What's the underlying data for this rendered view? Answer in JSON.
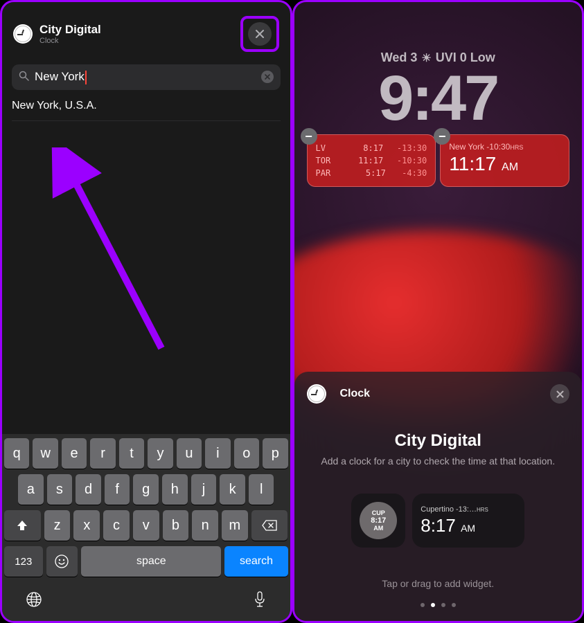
{
  "phone1": {
    "title": "City Digital",
    "subtitle": "Clock",
    "search_value": "New York",
    "result_0": "New York, U.S.A.",
    "keys_r1": [
      "q",
      "w",
      "e",
      "r",
      "t",
      "y",
      "u",
      "i",
      "o",
      "p"
    ],
    "keys_r2": [
      "a",
      "s",
      "d",
      "f",
      "g",
      "h",
      "j",
      "k",
      "l"
    ],
    "keys_r3": [
      "z",
      "x",
      "c",
      "v",
      "b",
      "n",
      "m"
    ],
    "key_123": "123",
    "key_space": "space",
    "key_search": "search"
  },
  "phone2": {
    "date_day": "Wed 3",
    "uvi": "UVI 0 Low",
    "time": "9:47",
    "widget_left": [
      {
        "city": "LV",
        "time": "8:17",
        "off": "-13:30"
      },
      {
        "city": "TOR",
        "time": "11:17",
        "off": "-10:30"
      },
      {
        "city": "PAR",
        "time": "5:17",
        "off": "-4:30"
      }
    ],
    "widget_ny_city": "New York",
    "widget_ny_off": "-10:30",
    "widget_ny_time": "11:17",
    "widget_ny_am": "AM",
    "sheet_app": "Clock",
    "sheet_h1": "City Digital",
    "sheet_p": "Add a clock for a city to check the time at that location.",
    "opt_sm_city": "CUP",
    "opt_sm_time": "8:17",
    "opt_sm_am": "AM",
    "opt_lg_city": "Cupertino",
    "opt_lg_off": "-13:…",
    "opt_lg_time": "8:17",
    "opt_lg_am": "AM",
    "hint": "Tap or drag to add widget.",
    "hrs_label": "HRS"
  }
}
